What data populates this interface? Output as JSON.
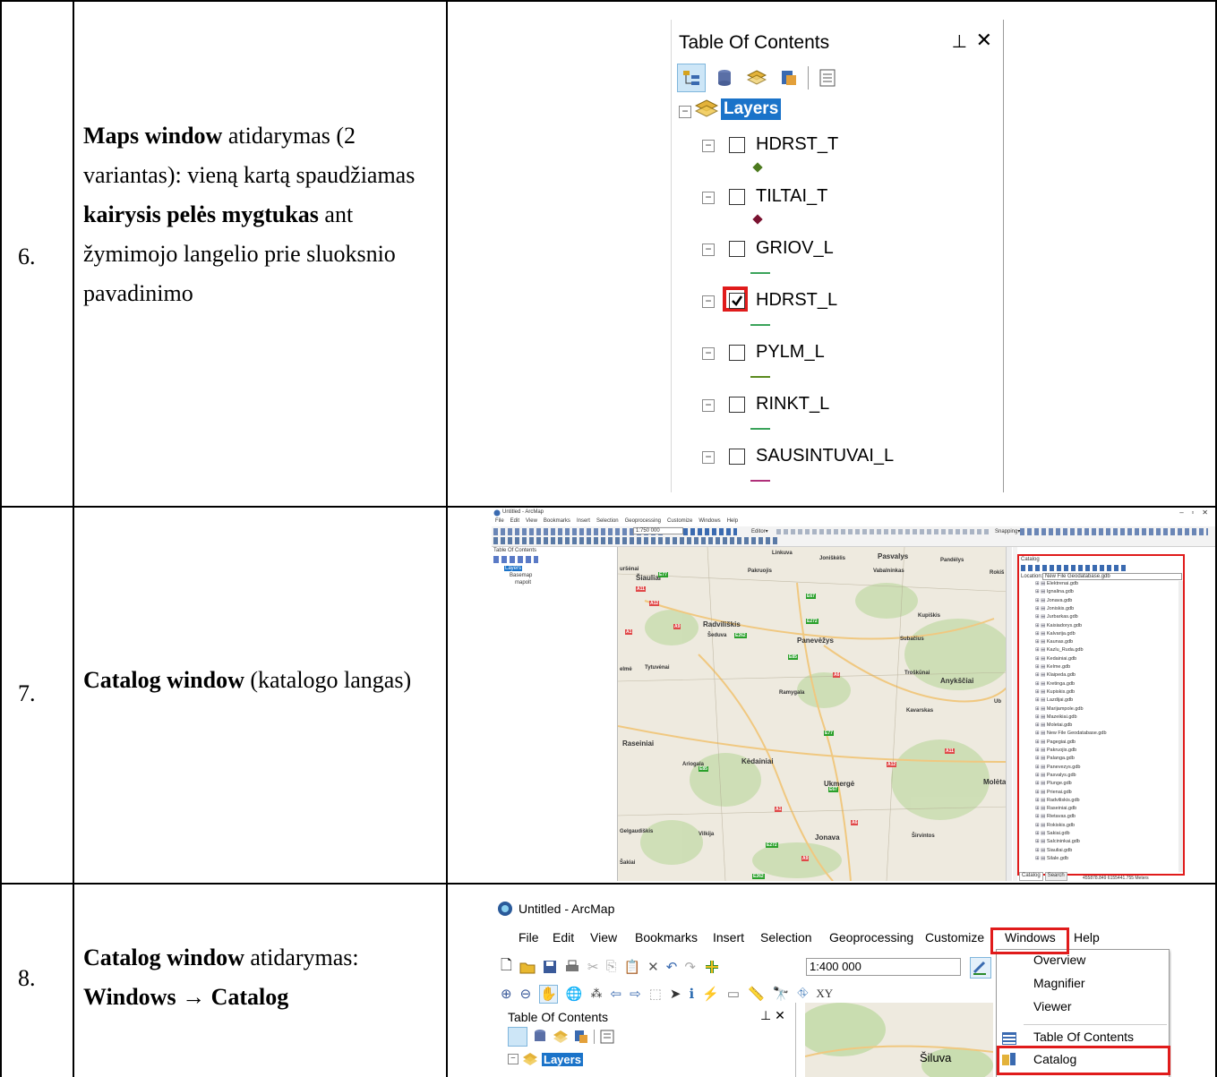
{
  "rows": [
    {
      "number": "6.",
      "desc_b1": "Maps window",
      "desc_t1": " atidarymas (2 variantas): vieną kartą spaudžiamas ",
      "desc_b2": "kairysis pelės mygtukas",
      "desc_t2": " ant žymimojo langelio prie sluoksnio pavadinimo"
    },
    {
      "number": "7.",
      "desc_b1": "Catalog window",
      "desc_t1": " (katalogo langas)"
    },
    {
      "number": "8.",
      "desc_b1": "Catalog window",
      "desc_t1": " atidarymas:",
      "desc_b2": "Windows → Catalog"
    }
  ],
  "toc": {
    "title": "Table Of Contents",
    "pin": "⊥",
    "close": "✕",
    "root": "Layers",
    "layers": [
      {
        "name": "HDRST_T",
        "checked": false,
        "symbol": "point",
        "color": "#4c7a1e"
      },
      {
        "name": "TILTAI_T",
        "checked": false,
        "symbol": "point",
        "color": "#7a1230"
      },
      {
        "name": "GRIOV_L",
        "checked": false,
        "symbol": "line",
        "color": "#3aa35a"
      },
      {
        "name": "HDRST_L",
        "checked": true,
        "symbol": "line",
        "color": "#3aa35a"
      },
      {
        "name": "PYLM_L",
        "checked": false,
        "symbol": "line",
        "color": "#5a8a1e"
      },
      {
        "name": "RINKT_L",
        "checked": false,
        "symbol": "line",
        "color": "#3aa35a"
      },
      {
        "name": "SAUSINTUVAI_L",
        "checked": false,
        "symbol": "line",
        "color": "#b0307a"
      }
    ]
  },
  "arcmap": {
    "title": "Untitled - ArcMap",
    "menu": [
      "File",
      "Edit",
      "View",
      "Bookmarks",
      "Insert",
      "Selection",
      "Geoprocessing",
      "Customize",
      "Windows",
      "Help"
    ],
    "scale": "1:750 000",
    "editor": "Editor▾",
    "snapping": "Snapping▾",
    "toc_title": "Table Of Contents",
    "toc_items": [
      "Layers",
      "Basemap",
      "mapolt"
    ],
    "catalog_title": "Catalog",
    "location_label": "Location:",
    "location_value": "New File Geodatabase.gdb",
    "catalog_items": [
      "Elektrenai.gdb",
      "Ignalina.gdb",
      "Jonava.gdb",
      "Joniskis.gdb",
      "Jurbarkas.gdb",
      "Kaisiadorys.gdb",
      "Kalvarija.gdb",
      "Kaunas.gdb",
      "Kazlu_Ruda.gdb",
      "Kedainiai.gdb",
      "Kelme.gdb",
      "Klaipeda.gdb",
      "Kretinga.gdb",
      "Kupiskis.gdb",
      "Lazdijai.gdb",
      "Marijampole.gdb",
      "Mazeikiai.gdb",
      "Moletai.gdb",
      "New File Geodatabase.gdb",
      "Pagegiai.gdb",
      "Pakruojis.gdb",
      "Palanga.gdb",
      "Panevezys.gdb",
      "Pasvalys.gdb",
      "Plunge.gdb",
      "Prienai.gdb",
      "Radviliskis.gdb",
      "Raseiniai.gdb",
      "Rietavas.gdb",
      "Rokiskis.gdb",
      "Sakiai.gdb",
      "Salcininkai.gdb",
      "Siauliai.gdb",
      "Silale.gdb"
    ],
    "catalog_tabs": [
      "Catalog",
      "Search"
    ],
    "status": "455878.849  6155441.755 Meters",
    "cities": [
      "Linkuva",
      "Joniškėlis",
      "Pasvalys",
      "Pandėlys",
      "uršėnai",
      "Pakruojis",
      "Vabalninkas",
      "Rokiš",
      "Šiauliai",
      "Kupiškis",
      "Radviliškis",
      "Subačius",
      "Šeduva",
      "Panevėžys",
      "elmė",
      "Tytuvėnai",
      "Troškūnai",
      "Anykščiai",
      "Ramygala",
      "Ub",
      "Kavarskas",
      "Raseiniai",
      "Kėdainiai",
      "Ariogala",
      "Ukmergė",
      "Molėtai",
      "Gelgaudiškis",
      "Vilkija",
      "Jonava",
      "Širvintos",
      "Šakiai"
    ],
    "road_labels": [
      "E77",
      "A11",
      "A12",
      "E67",
      "E272",
      "A9",
      "E262",
      "E85",
      "A1",
      "A6"
    ]
  },
  "arcmap2": {
    "title": "Untitled - ArcMap",
    "menu": [
      "File",
      "Edit",
      "View",
      "Bookmarks",
      "Insert",
      "Selection",
      "Geoprocessing",
      "Customize",
      "Windows",
      "Help"
    ],
    "scale": "1:400 000",
    "toc_title": "Table Of Contents",
    "layers_label": "Layers",
    "map_label": "Šiluva",
    "dropdown": [
      "Overview",
      "Magnifier",
      "Viewer",
      "Table Of Contents",
      "Catalog"
    ]
  },
  "colors": {
    "highlight_red": "#e01b1b",
    "catalog_blue": "#cde6f7",
    "map_bg": "#eeeadf"
  }
}
